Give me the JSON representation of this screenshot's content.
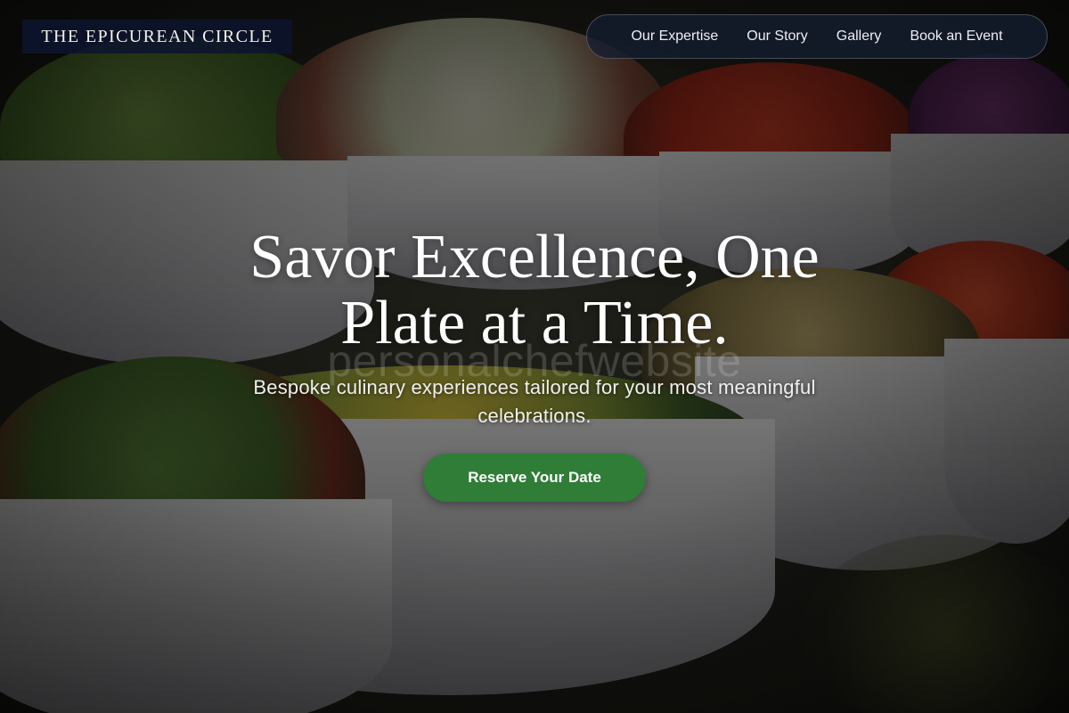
{
  "header": {
    "brand": "THE EPICUREAN CIRCLE",
    "nav": [
      "Our Expertise",
      "Our Story",
      "Gallery",
      "Book an Event"
    ]
  },
  "hero": {
    "title_line1": "Savor Excellence, One",
    "title_line2": "Plate at a Time.",
    "watermark": "personalchefwebsite",
    "subtitle_line1": "Bespoke culinary experiences tailored for your most meaningful",
    "subtitle_line2": "celebrations.",
    "cta_label": "Reserve Your Date"
  },
  "colors": {
    "brand_bg": "#0c142c",
    "nav_bg": "#141e30",
    "cta": "#2f7d36"
  }
}
